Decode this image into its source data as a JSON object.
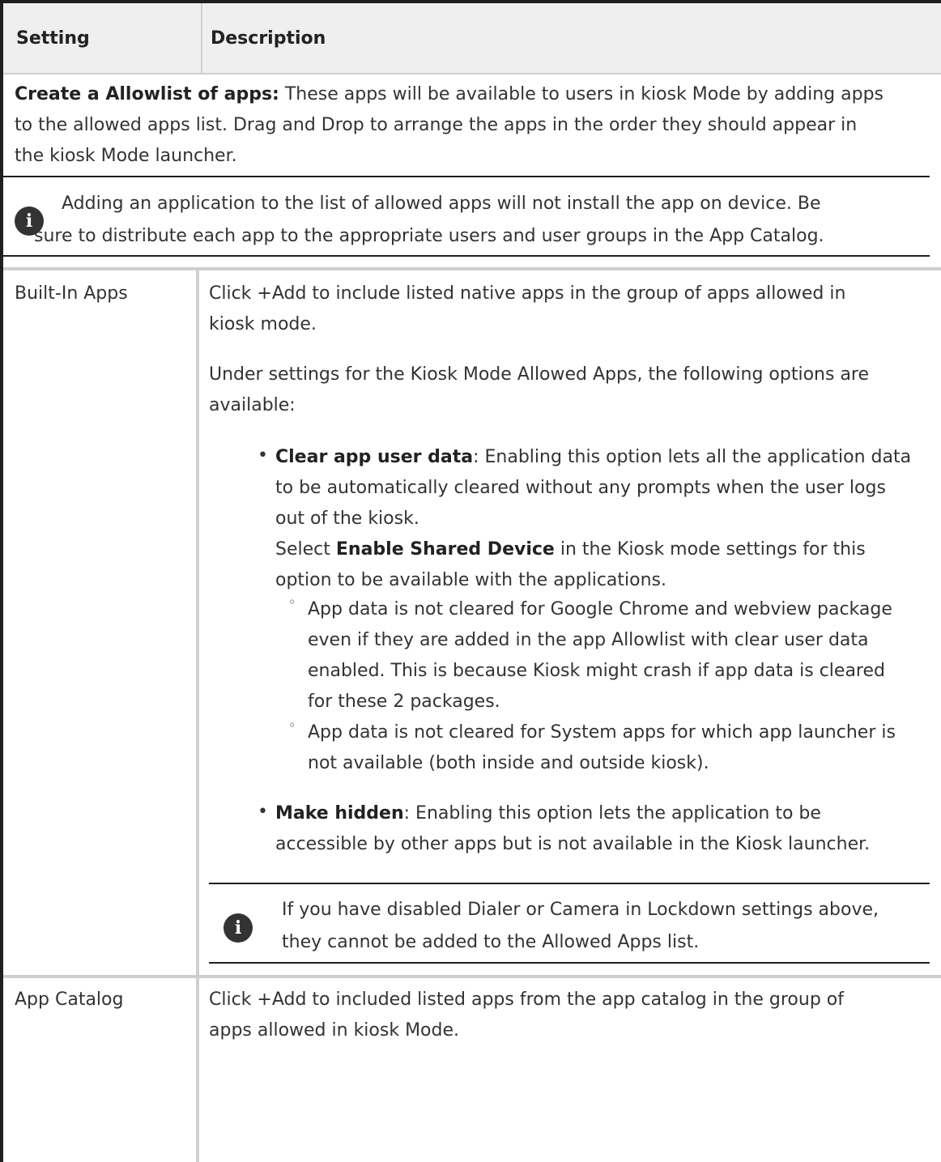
{
  "table": {
    "headers": [
      "Setting",
      "Description"
    ]
  },
  "intro": {
    "bold": "Create a Allowlist of apps:",
    "lines": [
      " These apps will be available to users in kiosk Mode by adding apps",
      "to the allowed apps list. Drag and Drop to arrange the apps in the order they should appear in",
      "the kiosk Mode launcher."
    ]
  },
  "note1": {
    "lines": [
      "Adding an application to the list of allowed apps will not install the app on device. Be",
      "sure to distribute each app to the appropriate users and user groups in the App Catalog."
    ]
  },
  "builtin": {
    "setting": "Built-In Apps",
    "desc": [
      "Click +Add to include listed native apps in the group of apps allowed in",
      "kiosk mode."
    ],
    "under": [
      "Under settings for the Kiosk Mode Allowed Apps, the following options are",
      "available:"
    ],
    "clear": {
      "bold": "Clear app user data",
      "lines": [
        ": Enabling this option lets all the application data",
        "to be automatically cleared without any prompts when the user logs",
        "out of the kiosk."
      ],
      "select_pre": "Select ",
      "select_bold": "Enable Shared Device",
      "select_post": " in the Kiosk mode settings for this",
      "select_line2": "option to be available with the applications."
    },
    "sub1": [
      "App data is not cleared for Google Chrome and webview package",
      "even if they are added in the app Allowlist with clear user data",
      "enabled. This is because Kiosk might crash if app data is cleared",
      "for these 2 packages."
    ],
    "sub2": [
      "App data is not cleared for System apps for which app launcher is",
      "not available (both inside and outside kiosk)."
    ],
    "hidden": {
      "bold": "Make hidden",
      "lines": [
        ": Enabling this option lets the application to be",
        "accessible by other apps but is not available in the Kiosk launcher."
      ]
    },
    "note2": [
      "If you have disabled Dialer or Camera in Lockdown settings above,",
      "they cannot be added to the Allowed Apps list."
    ]
  },
  "catalog": {
    "setting": "App Catalog",
    "desc": [
      "Click +Add to included listed apps from the app catalog in the group of",
      "apps allowed in kiosk Mode."
    ]
  }
}
